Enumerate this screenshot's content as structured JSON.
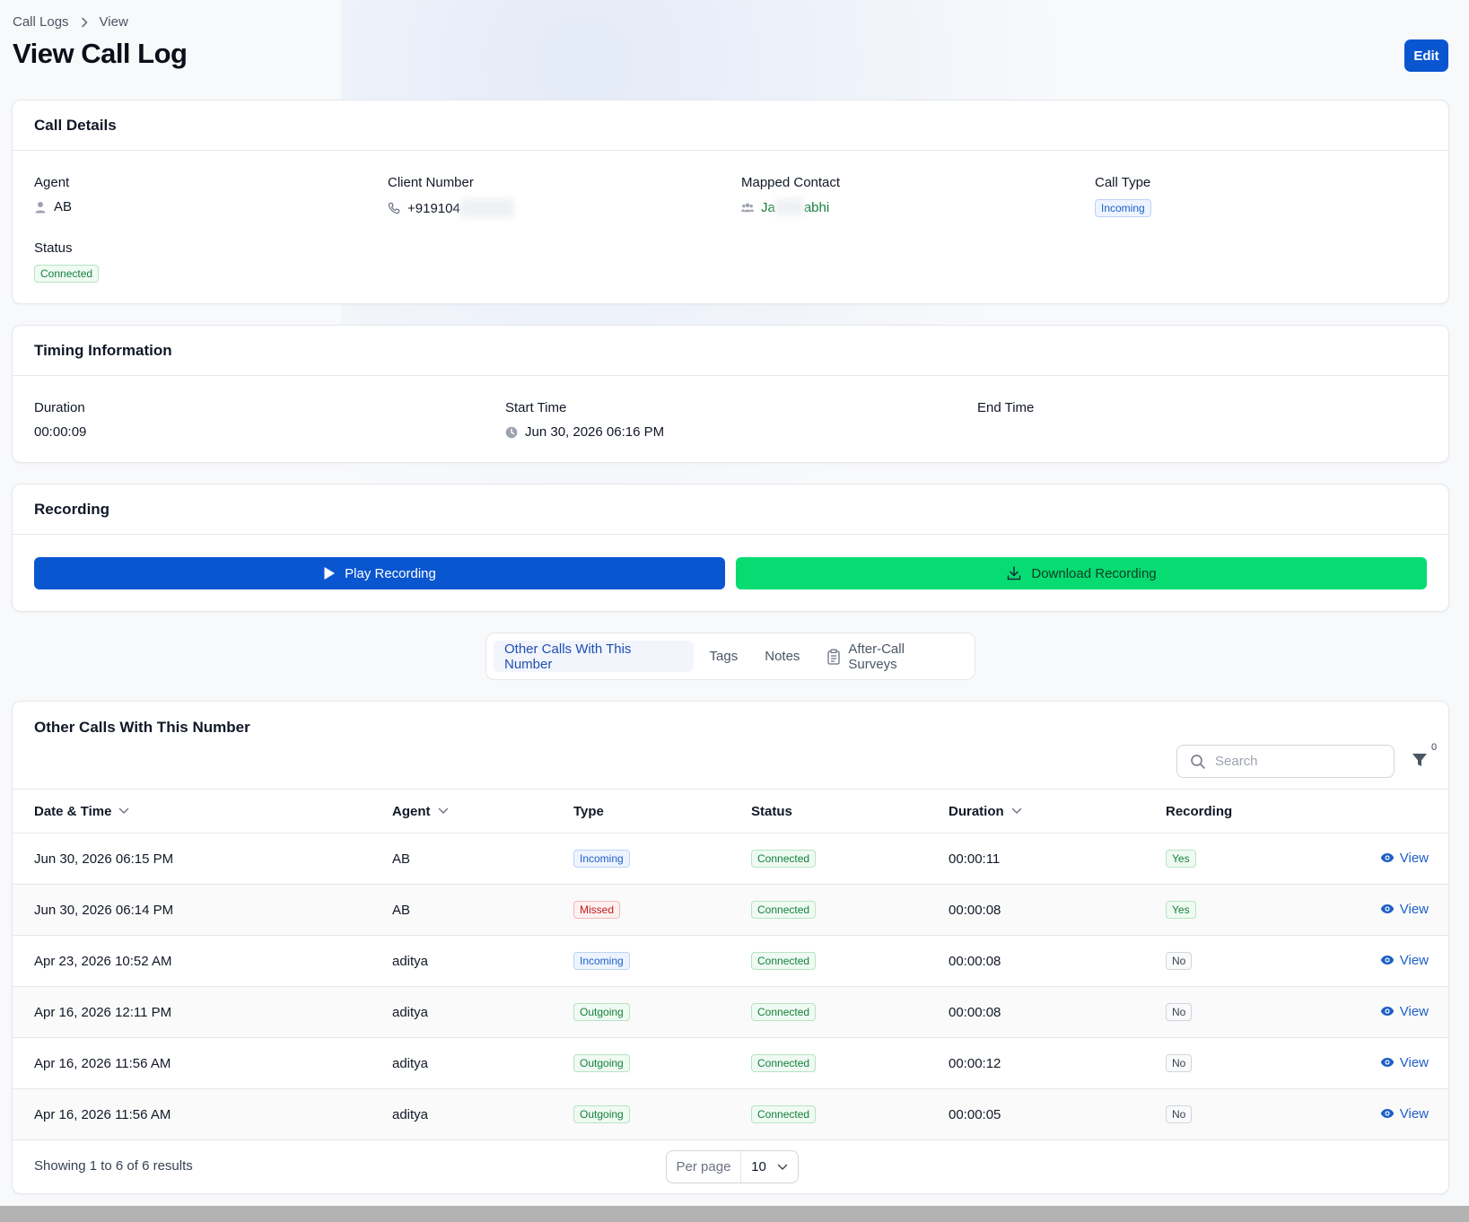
{
  "breadcrumb": {
    "parent": "Call Logs",
    "current": "View"
  },
  "page": {
    "title": "View Call Log",
    "edit_label": "Edit"
  },
  "call_details": {
    "title": "Call Details",
    "agent": {
      "label": "Agent",
      "value": "AB",
      "icon": "user-icon"
    },
    "client_number": {
      "label": "Client Number",
      "value": "+919104",
      "icon": "phone-icon"
    },
    "mapped_contact": {
      "label": "Mapped Contact",
      "value_start": "Ja",
      "value_end": "abhi",
      "icon": "users-icon"
    },
    "call_type": {
      "label": "Call Type",
      "value": "Incoming"
    },
    "status": {
      "label": "Status",
      "value": "Connected"
    }
  },
  "timing": {
    "title": "Timing Information",
    "duration": {
      "label": "Duration",
      "value": "00:00:09"
    },
    "start_time": {
      "label": "Start Time",
      "value": "Jun 30, 2026 06:16 PM",
      "icon": "clock-icon"
    },
    "end_time": {
      "label": "End Time",
      "value": ""
    }
  },
  "recording": {
    "title": "Recording",
    "play_label": "Play Recording",
    "download_label": "Download Recording"
  },
  "tabs": [
    {
      "label": "Other Calls With This Number",
      "active": true
    },
    {
      "label": "Tags",
      "active": false
    },
    {
      "label": "Notes",
      "active": false
    },
    {
      "label": "After-Call Surveys",
      "active": false,
      "icon": "clipboard-icon"
    }
  ],
  "other_calls": {
    "title": "Other Calls With This Number",
    "search_placeholder": "Search",
    "filter_count": "0",
    "columns": [
      "Date & Time",
      "Agent",
      "Type",
      "Status",
      "Duration",
      "Recording"
    ],
    "rows": [
      {
        "datetime": "Jun 30, 2026 06:15 PM",
        "agent": "AB",
        "type": "Incoming",
        "status": "Connected",
        "duration": "00:00:11",
        "recording": "Yes",
        "action": "View"
      },
      {
        "datetime": "Jun 30, 2026 06:14 PM",
        "agent": "AB",
        "type": "Missed",
        "status": "Connected",
        "duration": "00:00:08",
        "recording": "Yes",
        "action": "View"
      },
      {
        "datetime": "Apr 23, 2026 10:52 AM",
        "agent": "aditya",
        "type": "Incoming",
        "status": "Connected",
        "duration": "00:00:08",
        "recording": "No",
        "action": "View"
      },
      {
        "datetime": "Apr 16, 2026 12:11 PM",
        "agent": "aditya",
        "type": "Outgoing",
        "status": "Connected",
        "duration": "00:00:08",
        "recording": "No",
        "action": "View"
      },
      {
        "datetime": "Apr 16, 2026 11:56 AM",
        "agent": "aditya",
        "type": "Outgoing",
        "status": "Connected",
        "duration": "00:00:12",
        "recording": "No",
        "action": "View"
      },
      {
        "datetime": "Apr 16, 2026 11:56 AM",
        "agent": "aditya",
        "type": "Outgoing",
        "status": "Connected",
        "duration": "00:00:05",
        "recording": "No",
        "action": "View"
      }
    ],
    "results_text": "Showing 1 to 6 of 6 results",
    "per_page_label": "Per page",
    "per_page_value": "10"
  },
  "colors": {
    "primary": "#0a56d0",
    "download": "#06dc72",
    "incoming": "#1d5fc7",
    "outgoing": "#15803d",
    "missed": "#c11b1b"
  }
}
